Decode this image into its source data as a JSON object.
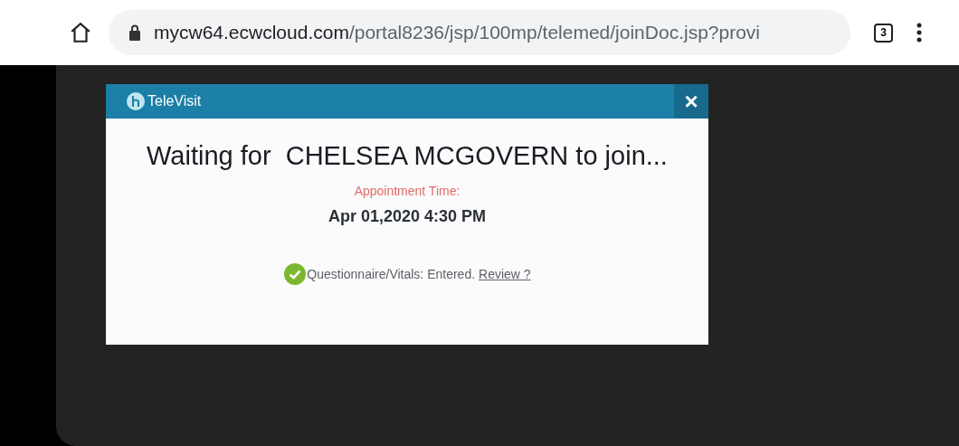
{
  "browser": {
    "url_host": "mycw64.ecwcloud.com",
    "url_path": "/portal8236/jsp/100mp/telemed/joinDoc.jsp?provi",
    "tab_count": "3"
  },
  "dialog": {
    "title": "TeleVisit",
    "close": "×",
    "heading": "Waiting for  CHELSEA MCGOVERN to join...",
    "time_label": "Appointment Time:",
    "time_value": "Apr 01,2020 4:30 PM",
    "status": {
      "checked": true,
      "text": "Questionnaire/Vitals: Entered.",
      "link": "Review ?"
    }
  }
}
